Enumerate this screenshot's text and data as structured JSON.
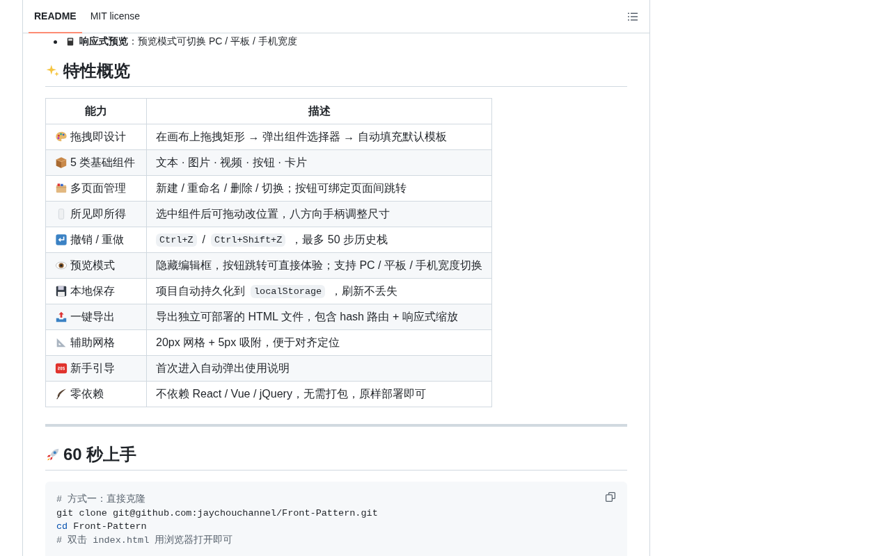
{
  "tabs": [
    {
      "label": "README",
      "selected": true
    },
    {
      "label": "MIT license",
      "selected": false
    }
  ],
  "partial_item": {
    "text": "**响应式预览**：预览模式可切换 PC / 平板 / 手机宽度"
  },
  "sections": [
    {
      "heading": "特性概览",
      "table": {
        "columns": [
          "能力",
          "描述"
        ],
        "rows": [
          {
            "name": "拖拽即设计",
            "description": [
              {
                "kind": "text",
                "text": "在画布上拖拽矩形 → 弹出组件选择器 → 自动填充默认模板"
              }
            ]
          },
          {
            "name": "5 类基础组件",
            "description": [
              {
                "kind": "text",
                "text": "文本 · 图片 · 视频 · 按钮 · 卡片"
              }
            ]
          },
          {
            "name": "多页面管理",
            "description": [
              {
                "kind": "text",
                "text": "新建 / 重命名 / 删除 / 切换；按钮可绑定页面间跳转"
              }
            ]
          },
          {
            "name": "所见即所得",
            "description": [
              {
                "kind": "text",
                "text": "选中组件后可拖动改位置，八方向手柄调整尺寸"
              }
            ]
          },
          {
            "name": "撤销 / 重做",
            "description": [
              {
                "kind": "code",
                "text": "Ctrl+Z"
              },
              {
                "kind": "text",
                "text": "/"
              },
              {
                "kind": "code",
                "text": "Ctrl+Shift+Z"
              },
              {
                "kind": "text",
                "text": "，最多 50 步历史栈"
              }
            ]
          },
          {
            "name": "预览模式",
            "description": [
              {
                "kind": "text",
                "text": "隐藏编辑框，按钮跳转可直接体验；支持 PC / 平板 / 手机宽度切换"
              }
            ]
          },
          {
            "name": "本地保存",
            "description": [
              {
                "kind": "text",
                "text": "项目自动持久化到"
              },
              {
                "kind": "code",
                "text": "localStorage"
              },
              {
                "kind": "text",
                "text": "，刷新不丢失"
              }
            ]
          },
          {
            "name": "一键导出",
            "description": [
              {
                "kind": "text",
                "text": "导出独立可部署的 HTML 文件，包含 hash 路由 + 响应式缩放"
              }
            ]
          },
          {
            "name": "辅助网格",
            "description": [
              {
                "kind": "text",
                "text": "20px 网格 + 5px 吸附，便于对齐定位"
              }
            ]
          },
          {
            "name": "新手引导",
            "description": [
              {
                "kind": "text",
                "text": "首次进入自动弹出使用说明"
              }
            ]
          },
          {
            "name": "零依赖",
            "description": [
              {
                "kind": "text",
                "text": "不依赖 React / Vue / jQuery，无需打包，原样部署即可"
              }
            ]
          }
        ]
      }
    },
    {
      "heading": "60 秒上手",
      "code": [
        [
          {
            "kind": "comment",
            "text": "# 方式一：直接克隆"
          }
        ],
        [
          {
            "kind": "plain",
            "text": "git clone git@github.com:jaychouchannel/Front-Pattern.git"
          }
        ],
        [
          {
            "kind": "keyword",
            "text": "cd"
          },
          {
            "kind": "plain",
            "text": " Front-Pattern"
          }
        ],
        [
          {
            "kind": "comment",
            "text": "# 双击 index.html 用浏览器打开即可"
          }
        ]
      ]
    }
  ]
}
